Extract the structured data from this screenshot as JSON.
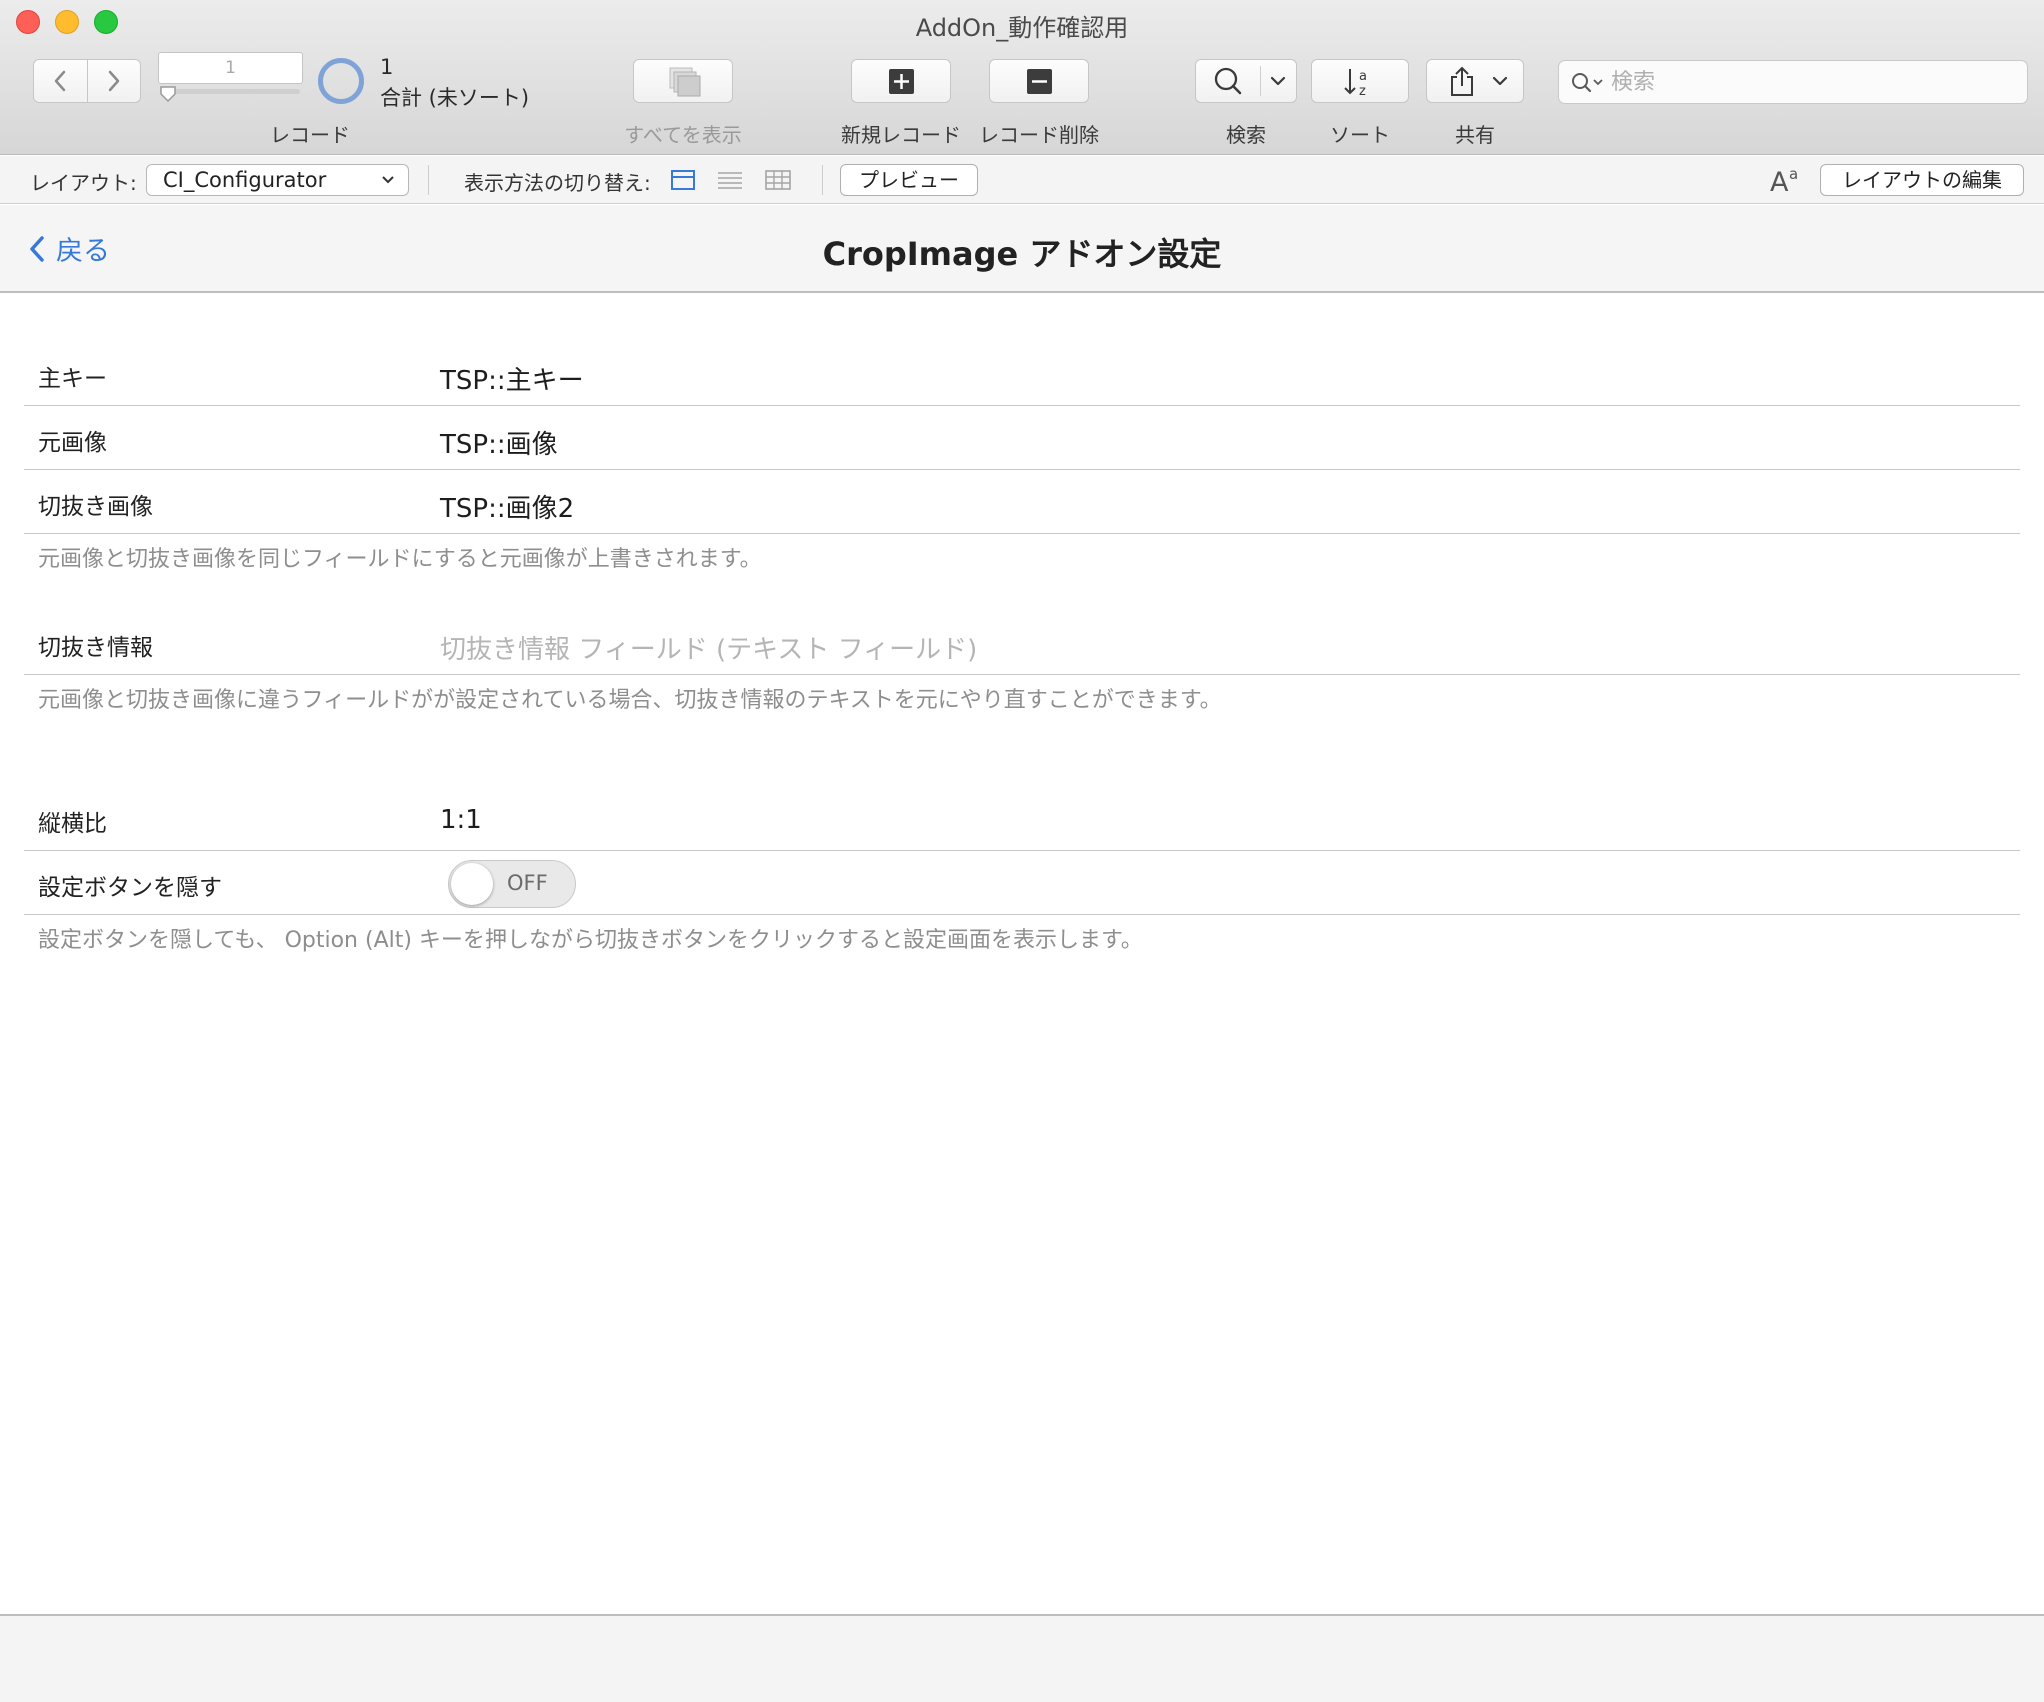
{
  "window": {
    "title": "AddOn_動作確認用"
  },
  "toolbar": {
    "record_number": "1",
    "record_label": "レコード",
    "found_count": "1",
    "found_status": "合計 (未ソート)",
    "show_all_label": "すべてを表示",
    "new_record_label": "新規レコード",
    "delete_record_label": "レコード削除",
    "find_label": "検索",
    "sort_label": "ソート",
    "share_label": "共有",
    "search_placeholder": "検索"
  },
  "layout_bar": {
    "layout_label": "レイアウト:",
    "layout_value": "CI_Configurator",
    "view_as_label": "表示方法の切り替え:",
    "preview_label": "プレビュー",
    "edit_layout_label": "レイアウトの編集"
  },
  "header": {
    "back_label": "戻る",
    "title": "CropImage アドオン設定"
  },
  "form": {
    "primary_key": {
      "label": "主キー",
      "value": "TSP::主キー"
    },
    "source_image": {
      "label": "元画像",
      "value": "TSP::画像"
    },
    "cropped_image": {
      "label": "切抜き画像",
      "value": "TSP::画像2"
    },
    "note_overwrite": "元画像と切抜き画像を同じフィールドにすると元画像が上書きされます。",
    "crop_info": {
      "label": "切抜き情報",
      "placeholder": "切抜き情報 フィールド (テキスト フィールド)"
    },
    "note_crop_info": "元画像と切抜き画像に違うフィールドがが設定されている場合、切抜き情報のテキストを元にやり直すことができます。",
    "aspect_ratio": {
      "label": "縦横比",
      "value": "1:1"
    },
    "hide_settings_button": {
      "label": "設定ボタンを隠す",
      "toggle_state": "OFF"
    },
    "note_hide_settings": "設定ボタンを隠しても、 Option (Alt) キーを押しながら切抜きボタンをクリックすると設定画面を表示します。"
  },
  "colors": {
    "accent": "#3679d8",
    "progress_ring": "#7fa3d6"
  }
}
